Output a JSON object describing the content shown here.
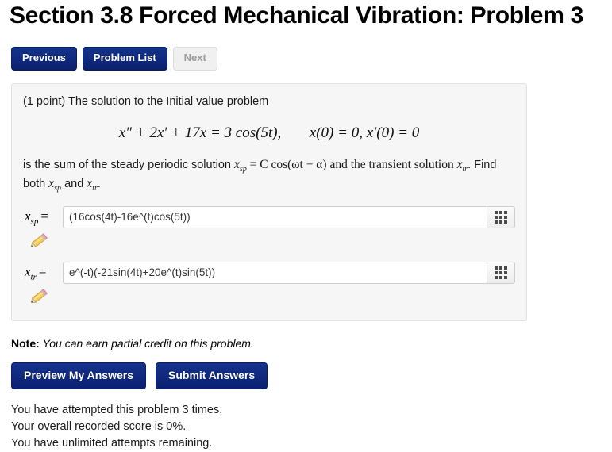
{
  "page_title": "Section 3.8 Forced Mechanical Vibration: Problem 3",
  "nav": {
    "previous_label": "Previous",
    "problem_list_label": "Problem List",
    "next_label": "Next"
  },
  "problem": {
    "intro": "(1 point) The solution to the Initial value problem",
    "equation": {
      "lhs": "x″ + 2x′ + 17x = 3 cos(5t),",
      "initial_conditions": "x(0) = 0, x′(0) = 0"
    },
    "body_prefix": "is the sum of the steady periodic solution ",
    "body_sp_var": "x",
    "body_sp_sub": "sp",
    "body_mid": " = C cos(ωt − α) and the transient solution ",
    "body_tr_var": "x",
    "body_tr_sub": "tr",
    "body_suffix": ". Find both ",
    "body_end": " and ",
    "body_period": "."
  },
  "answers": [
    {
      "label_var": "x",
      "label_sub": "sp",
      "equals": "=",
      "value": "(16cos(4t)-16e^(t)cos(5t))",
      "placeholder": "",
      "keypad_icon": "grid-icon",
      "pencil_icon": "pencil-icon"
    },
    {
      "label_var": "x",
      "label_sub": "tr",
      "equals": "=",
      "value": "e^(-t)(-21sin(4t)+20e^(t)sin(5t))",
      "placeholder": "",
      "keypad_icon": "grid-icon",
      "pencil_icon": "pencil-icon"
    }
  ],
  "note": {
    "label": "Note:",
    "text": "You can earn partial credit on this problem."
  },
  "actions": {
    "preview_label": "Preview My Answers",
    "submit_label": "Submit Answers"
  },
  "status": {
    "attempts": "You have attempted this problem 3 times.",
    "score": "Your overall recorded score is 0%.",
    "remaining": "You have unlimited attempts remaining."
  },
  "colors": {
    "button_primary": "#0b2071",
    "button_disabled_bg": "#f0f0f0",
    "button_disabled_text": "#9a9a9a",
    "panel_bg": "#f6f6f6",
    "panel_border": "#e2e2e2"
  }
}
